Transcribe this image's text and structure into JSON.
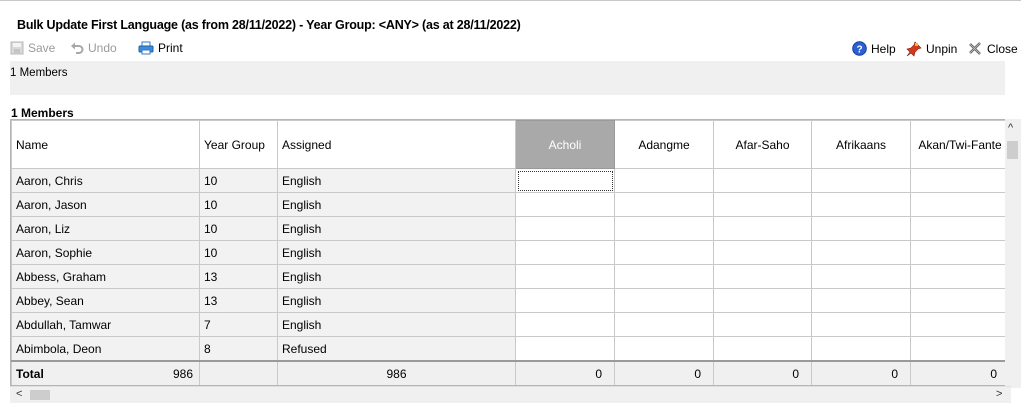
{
  "title": "Bulk Update First Language (as from 28/11/2022) - Year Group: <ANY> (as at 28/11/2022)",
  "toolbar": {
    "save": "Save",
    "undo": "Undo",
    "print": "Print",
    "help": "Help",
    "unpin": "Unpin",
    "close": "Close"
  },
  "status_text": "1 Members",
  "section_label": "1 Members",
  "columns": {
    "name": "Name",
    "year_group": "Year Group",
    "assigned": "Assigned",
    "languages": [
      "Acholi",
      "Adangme",
      "Afar-Saho",
      "Afrikaans",
      "Akan/Twi-Fante"
    ]
  },
  "rows": [
    {
      "name": "Aaron, Chris",
      "year": "10",
      "assigned": "English"
    },
    {
      "name": "Aaron, Jason",
      "year": "10",
      "assigned": "English"
    },
    {
      "name": "Aaron, Liz",
      "year": "10",
      "assigned": "English"
    },
    {
      "name": "Aaron, Sophie",
      "year": "10",
      "assigned": "English"
    },
    {
      "name": "Abbess, Graham",
      "year": "13",
      "assigned": "English"
    },
    {
      "name": "Abbey, Sean",
      "year": "13",
      "assigned": "English"
    },
    {
      "name": "Abdullah, Tamwar",
      "year": "7",
      "assigned": "English"
    },
    {
      "name": "Abimbola, Deon",
      "year": "8",
      "assigned": "Refused"
    }
  ],
  "totals": {
    "label": "Total",
    "count": "986",
    "assigned": "986",
    "languages": [
      "0",
      "0",
      "0",
      "0",
      "0"
    ]
  },
  "colors": {
    "selected_header": "#a9a9a9",
    "fixed_cell": "#f2f2f2"
  }
}
